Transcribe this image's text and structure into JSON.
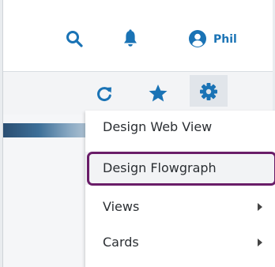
{
  "header": {
    "user_name": "Phil",
    "icons": [
      "search-icon",
      "bell-icon",
      "user-icon"
    ]
  },
  "toolbar": {
    "icons": [
      "refresh-icon",
      "star-icon",
      "gear-icon"
    ]
  },
  "menu": {
    "items": [
      {
        "label": "Design Web View",
        "has_submenu": false
      },
      {
        "label": "Design Flowgraph",
        "has_submenu": false,
        "highlighted": true
      },
      {
        "label": "Views",
        "has_submenu": true
      },
      {
        "label": "Cards",
        "has_submenu": true
      }
    ]
  },
  "colors": {
    "accent": "#1a73b5",
    "highlight_border": "#6a1d68"
  }
}
